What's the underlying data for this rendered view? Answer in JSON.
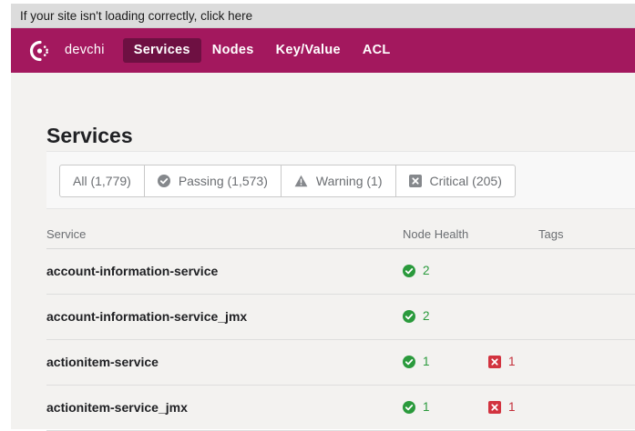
{
  "notice": {
    "text": "If your site isn't loading correctly, click here"
  },
  "topbar": {
    "datacenter": "devchi",
    "nav": [
      "Services",
      "Nodes",
      "Key/Value",
      "ACL"
    ],
    "active": "Services",
    "colors": {
      "bar": "#a3185e",
      "active": "#6e1042"
    }
  },
  "page": {
    "title": "Services"
  },
  "filters": {
    "all": "All (1,779)",
    "passing": "Passing (1,573)",
    "warning": "Warning (1)",
    "critical": "Critical (205)"
  },
  "table": {
    "headers": {
      "service": "Service",
      "health": "Node Health",
      "tags": "Tags"
    },
    "rows": [
      {
        "name": "account-information-service",
        "passing": "2",
        "critical": ""
      },
      {
        "name": "account-information-service_jmx",
        "passing": "2",
        "critical": ""
      },
      {
        "name": "actionitem-service",
        "passing": "1",
        "critical": "1"
      },
      {
        "name": "actionitem-service_jmx",
        "passing": "1",
        "critical": "1"
      }
    ]
  },
  "icons": {
    "logo": "consul-logo-icon",
    "passing": "check-circle-icon",
    "warning": "warning-triangle-icon",
    "critical": "x-square-icon"
  },
  "status_colors": {
    "passing": "#2a9a3c",
    "critical": "#c42f3a",
    "warning": "#6b6e72"
  }
}
